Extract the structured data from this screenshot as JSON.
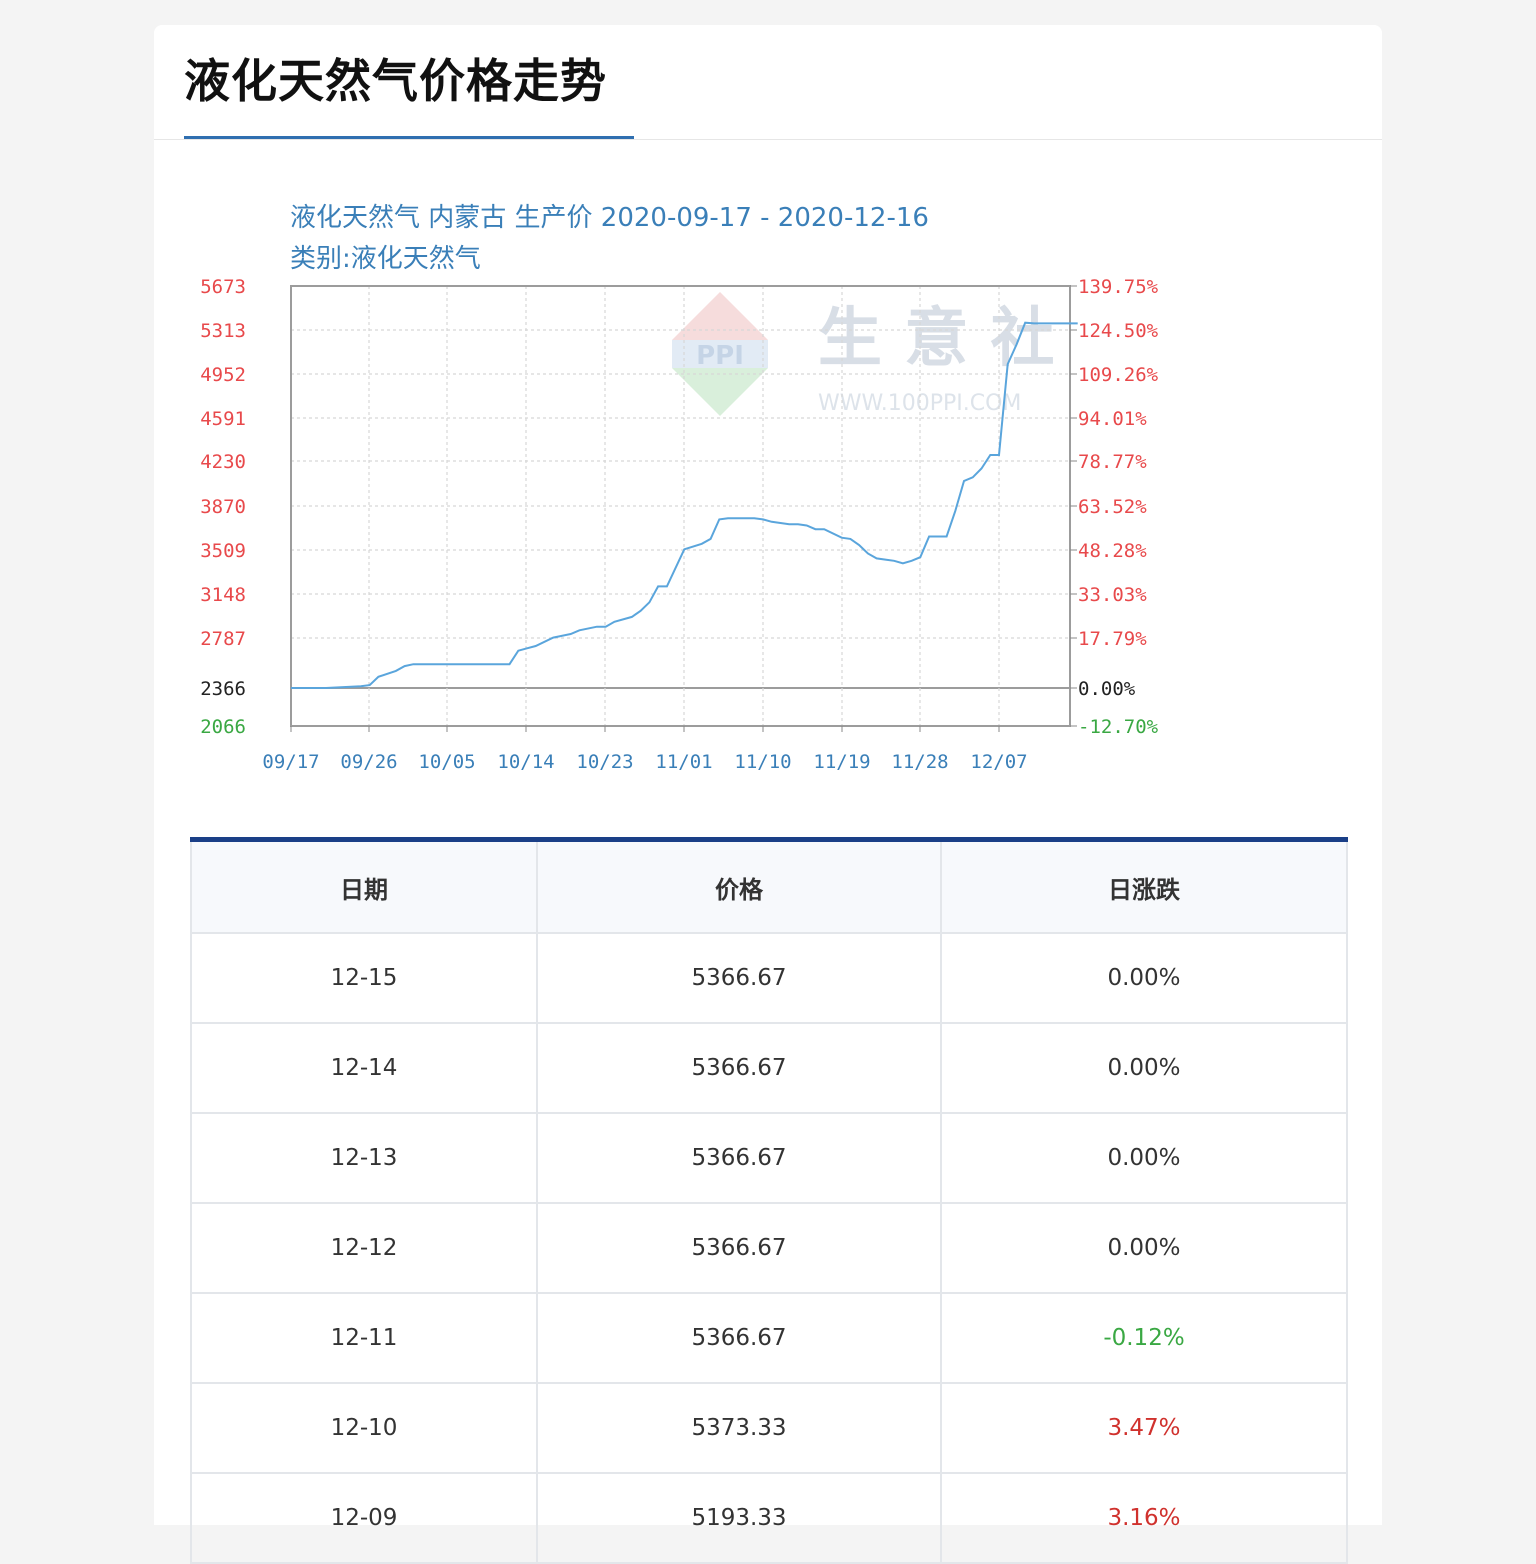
{
  "page": {
    "title": "液化天然气价格走势"
  },
  "chart_data": {
    "type": "line",
    "title": "液化天然气 内蒙古 生产价 2020-09-17 - 2020-12-16",
    "subtitle": "类别:液化天然气",
    "x_tick_labels": [
      "09/17",
      "09/26",
      "10/05",
      "10/14",
      "10/23",
      "11/01",
      "11/10",
      "11/19",
      "11/28",
      "12/07"
    ],
    "y_left_ticks": [
      "5673",
      "5313",
      "4952",
      "4591",
      "4230",
      "3870",
      "3509",
      "3148",
      "2787",
      "2366",
      "2066"
    ],
    "y_right_ticks": [
      "139.75%",
      "124.50%",
      "109.26%",
      "94.01%",
      "78.77%",
      "63.52%",
      "48.28%",
      "33.03%",
      "17.79%",
      "0.00%",
      "-12.70%"
    ],
    "ylim": [
      2066,
      5673
    ],
    "xlim_days": [
      0,
      90
    ],
    "grid": true,
    "watermark": {
      "text": "生 意 社",
      "url": "WWW.100PPI.COM",
      "logo": "PPI"
    },
    "colors": {
      "line": "#5aa5dc",
      "axis_text": "#3a7fb8",
      "up": "#e8494b",
      "down": "#3aa843",
      "neutral": "#222222"
    },
    "series": [
      {
        "x": [
          "09-17",
          "09-21",
          "09-25",
          "09-26",
          "09-27",
          "09-29",
          "09-30",
          "10-01",
          "10-02",
          "10-04",
          "10-06",
          "10-08",
          "10-10",
          "10-12",
          "10-13",
          "10-14",
          "10-15",
          "10-17",
          "10-19",
          "10-20",
          "10-22",
          "10-23",
          "10-24",
          "10-26",
          "10-27",
          "10-28",
          "10-29",
          "10-30",
          "11-01",
          "11-03",
          "11-04",
          "11-05",
          "11-06",
          "11-08",
          "11-09",
          "11-10",
          "11-11",
          "11-13",
          "11-14",
          "11-15",
          "11-16",
          "11-17",
          "11-19",
          "11-20",
          "11-21",
          "11-22",
          "11-23",
          "11-24",
          "11-25",
          "11-26",
          "11-27",
          "11-28",
          "11-29",
          "11-30",
          "12-01",
          "12-02",
          "12-03",
          "12-04",
          "12-05",
          "12-06",
          "12-07",
          "12-08",
          "12-09",
          "12-10",
          "12-11",
          "12-12",
          "12-13",
          "12-14",
          "12-15",
          "12-16"
        ],
        "y": [
          2366,
          2366,
          2380,
          2390,
          2460,
          2510,
          2550,
          2566,
          2566,
          2566,
          2566,
          2566,
          2566,
          2566,
          2680,
          2700,
          2720,
          2790,
          2820,
          2850,
          2880,
          2880,
          2920,
          2960,
          3010,
          3080,
          3210,
          3210,
          3515,
          3560,
          3600,
          3760,
          3770,
          3770,
          3770,
          3760,
          3740,
          3720,
          3720,
          3710,
          3680,
          3680,
          3610,
          3600,
          3550,
          3480,
          3440,
          3430,
          3420,
          3400,
          3420,
          3450,
          3620,
          3620,
          3620,
          3830,
          4070,
          4100,
          4170,
          4280,
          4280,
          5033,
          5193,
          5373,
          5367,
          5367,
          5367,
          5367,
          5367,
          5367
        ]
      }
    ]
  },
  "table": {
    "headers": [
      "日期",
      "价格",
      "日涨跌"
    ],
    "rows": [
      {
        "date": "12-15",
        "price": "5366.67",
        "change": "0.00%",
        "trend": "flat"
      },
      {
        "date": "12-14",
        "price": "5366.67",
        "change": "0.00%",
        "trend": "flat"
      },
      {
        "date": "12-13",
        "price": "5366.67",
        "change": "0.00%",
        "trend": "flat"
      },
      {
        "date": "12-12",
        "price": "5366.67",
        "change": "0.00%",
        "trend": "flat"
      },
      {
        "date": "12-11",
        "price": "5366.67",
        "change": "-0.12%",
        "trend": "down"
      },
      {
        "date": "12-10",
        "price": "5373.33",
        "change": "3.47%",
        "trend": "up"
      },
      {
        "date": "12-09",
        "price": "5193.33",
        "change": "3.16%",
        "trend": "up"
      }
    ]
  }
}
